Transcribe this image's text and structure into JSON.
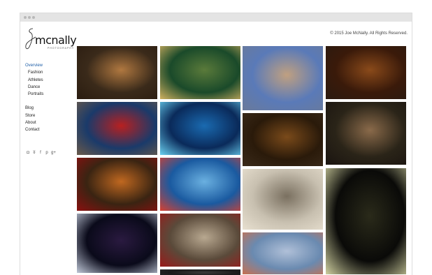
{
  "window": {
    "dots": 3
  },
  "site": {
    "logo_text": "mcnally",
    "logo_sub": "PHOTOGRAPHY",
    "copyright": "© 2015 Joe McNally. All Rights Reserved."
  },
  "nav": {
    "primary": [
      {
        "label": "Overview",
        "active": true
      },
      {
        "label": "Fashion",
        "sub": true
      },
      {
        "label": "Athletes",
        "sub": true
      },
      {
        "label": "Dance",
        "sub": true
      },
      {
        "label": "Portraits",
        "sub": true
      }
    ],
    "secondary": [
      {
        "label": "Blog"
      },
      {
        "label": "Store"
      },
      {
        "label": "About"
      },
      {
        "label": "Contact"
      }
    ]
  },
  "social": [
    {
      "icon": "instagram-icon",
      "glyph": "◘"
    },
    {
      "icon": "twitter-icon",
      "glyph": "ʬ"
    },
    {
      "icon": "facebook-icon",
      "glyph": "f"
    },
    {
      "icon": "pinterest-icon",
      "glyph": "p"
    },
    {
      "icon": "google-plus-icon",
      "glyph": "g+"
    }
  ],
  "gallery": {
    "columns": [
      [
        {
          "name": "photo-gold-cape",
          "colors": [
            "#3a2a1a",
            "#b07840",
            "#2a1c10"
          ]
        },
        {
          "name": "photo-red-dress-temple",
          "colors": [
            "#1a3a6a",
            "#b82020",
            "#6a5a4a"
          ]
        },
        {
          "name": "photo-red-gown-arch",
          "colors": [
            "#3a2412",
            "#c06820",
            "#8a1010"
          ]
        },
        {
          "name": "photo-dancer-stage",
          "colors": [
            "#0a0a1a",
            "#2a1a40",
            "#c0c8d8"
          ]
        }
      ],
      [
        {
          "name": "photo-sprinter",
          "colors": [
            "#1a4a2a",
            "#5a7a3a",
            "#d0b060"
          ]
        },
        {
          "name": "photo-shark-school",
          "colors": [
            "#0a2a5a",
            "#1a6ab0",
            "#6ad0f0"
          ]
        },
        {
          "name": "photo-swimmers",
          "colors": [
            "#1a5aa0",
            "#6ab0e0",
            "#d84030"
          ]
        },
        {
          "name": "photo-street-crowd",
          "colors": [
            "#5a4a3a",
            "#b8a890",
            "#9a1a1a"
          ]
        },
        {
          "name": "photo-dark-strip",
          "colors": [
            "#1a1a1a",
            "#3a3a3a",
            "#2a2a2a"
          ]
        }
      ],
      [
        {
          "name": "photo-ballerina-kremlin",
          "colors": [
            "#5a7ab8",
            "#c0a080",
            "#6a7a9a"
          ]
        },
        {
          "name": "photo-seated-man-library",
          "colors": [
            "#2a1a0a",
            "#7a4a1a",
            "#3a2a1a"
          ]
        },
        {
          "name": "photo-dancer-hall",
          "colors": [
            "#c8c0b0",
            "#7a7060",
            "#e8e0d0"
          ]
        },
        {
          "name": "photo-ballet-studio",
          "colors": [
            "#6a8ab0",
            "#b0c0d8",
            "#c87050"
          ]
        }
      ],
      [
        {
          "name": "photo-wheel-portrait",
          "colors": [
            "#3a1a0a",
            "#8a4a1a",
            "#2a1a10"
          ]
        },
        {
          "name": "photo-ballerina-room",
          "colors": [
            "#2a2418",
            "#8a6a4a",
            "#1a1410"
          ]
        },
        {
          "name": "photo-trumpeter-window",
          "colors": [
            "#0a0a08",
            "#2a2a1a",
            "#d0d0a0"
          ]
        }
      ]
    ]
  }
}
